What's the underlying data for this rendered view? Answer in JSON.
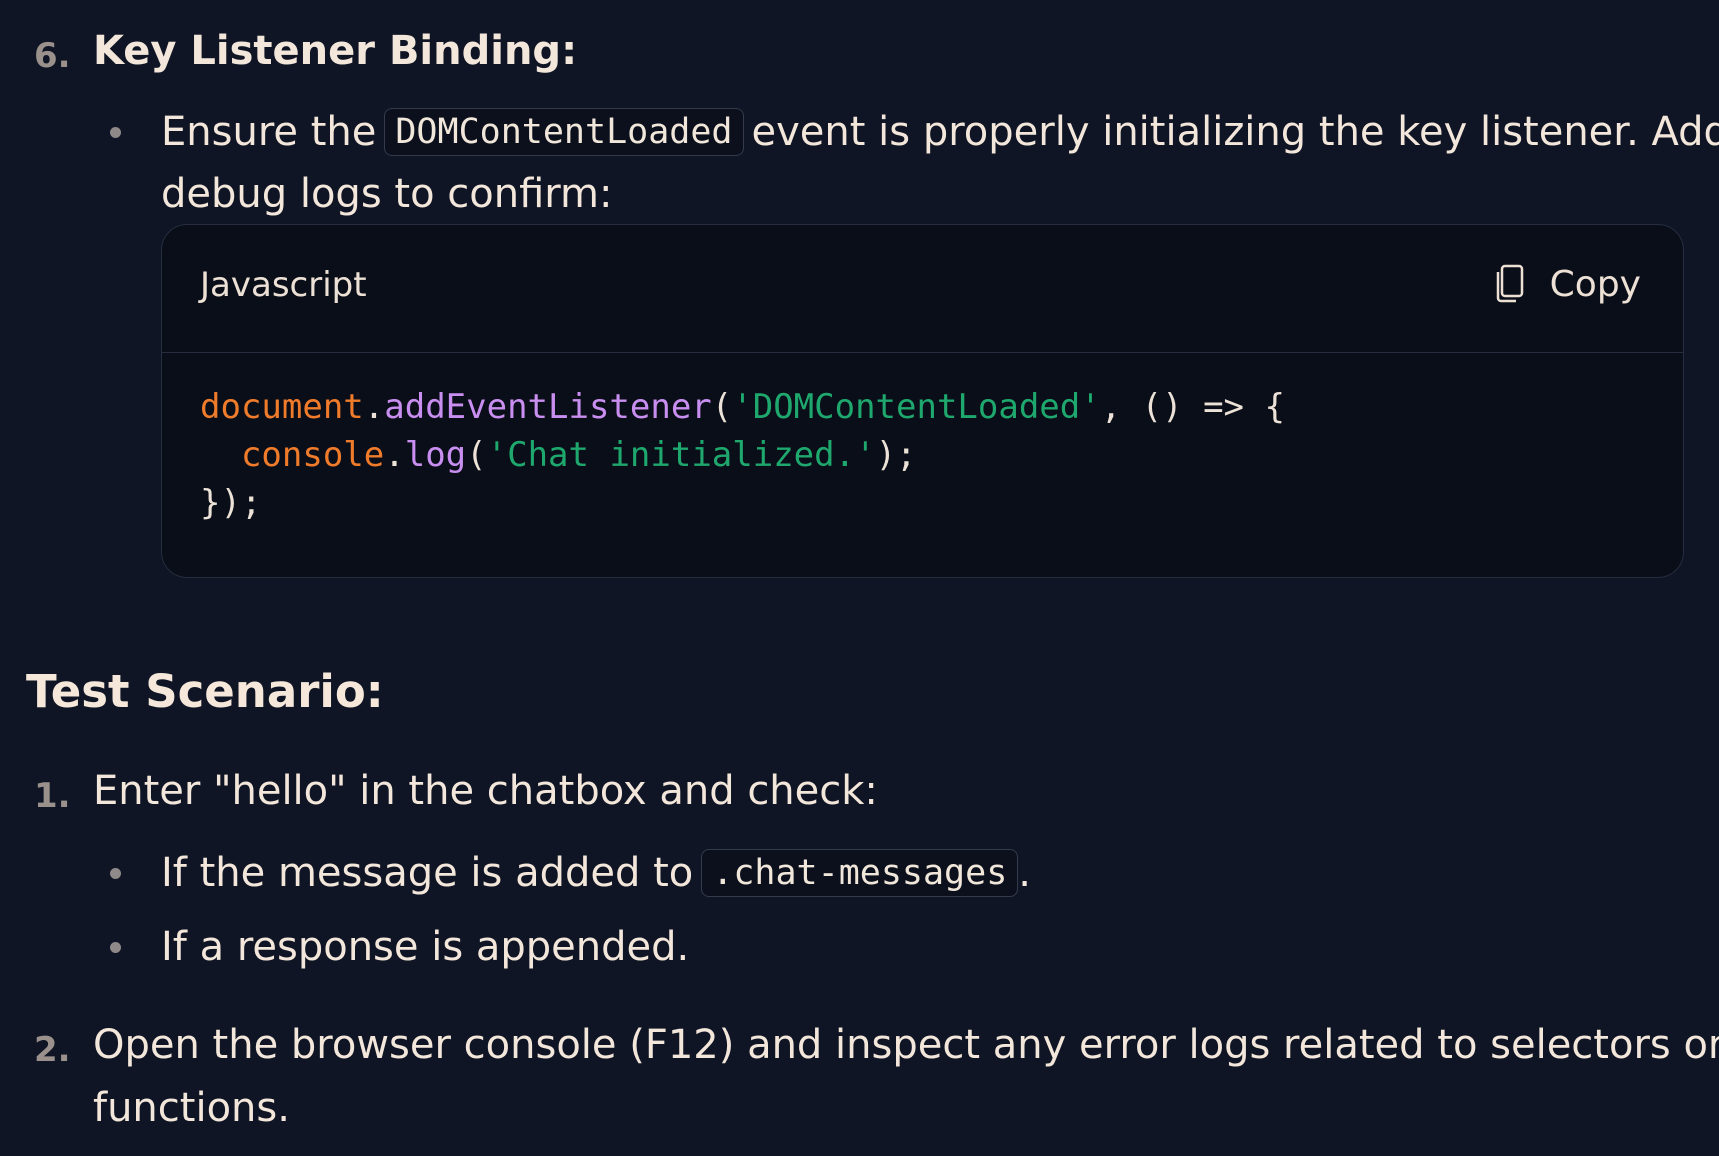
{
  "step6": {
    "number": "6.",
    "title": "Key Listener Binding:",
    "bullet": {
      "text_before": "Ensure the",
      "code": "DOMContentLoaded",
      "text_after": "event is properly initializing the key listener. Add",
      "line2": "debug logs to confirm:"
    }
  },
  "code_block": {
    "language": "Javascript",
    "copy_label": "Copy",
    "line1": {
      "obj": "document",
      "dot": ".",
      "fn": "addEventListener",
      "open": "(",
      "str": "'DOMContentLoaded'",
      "rest": ", () => {"
    },
    "line2": {
      "indent": "  ",
      "obj": "console",
      "dot": ".",
      "fn": "log",
      "open": "(",
      "str": "'Chat initialized.'",
      "rest": ");"
    },
    "line3": "});"
  },
  "test_heading": "Test Scenario:",
  "test_steps": [
    {
      "number": "1.",
      "text": "Enter \"hello\" in the chatbox and check:",
      "bullets": [
        {
          "text_before": "If the message is added to",
          "code": ".chat-messages",
          "text_after": "."
        },
        {
          "text": "If a response is appended."
        }
      ]
    },
    {
      "number": "2.",
      "line1": "Open the browser console (F12) and inspect any error logs related to selectors or",
      "line2": "functions."
    }
  ]
}
